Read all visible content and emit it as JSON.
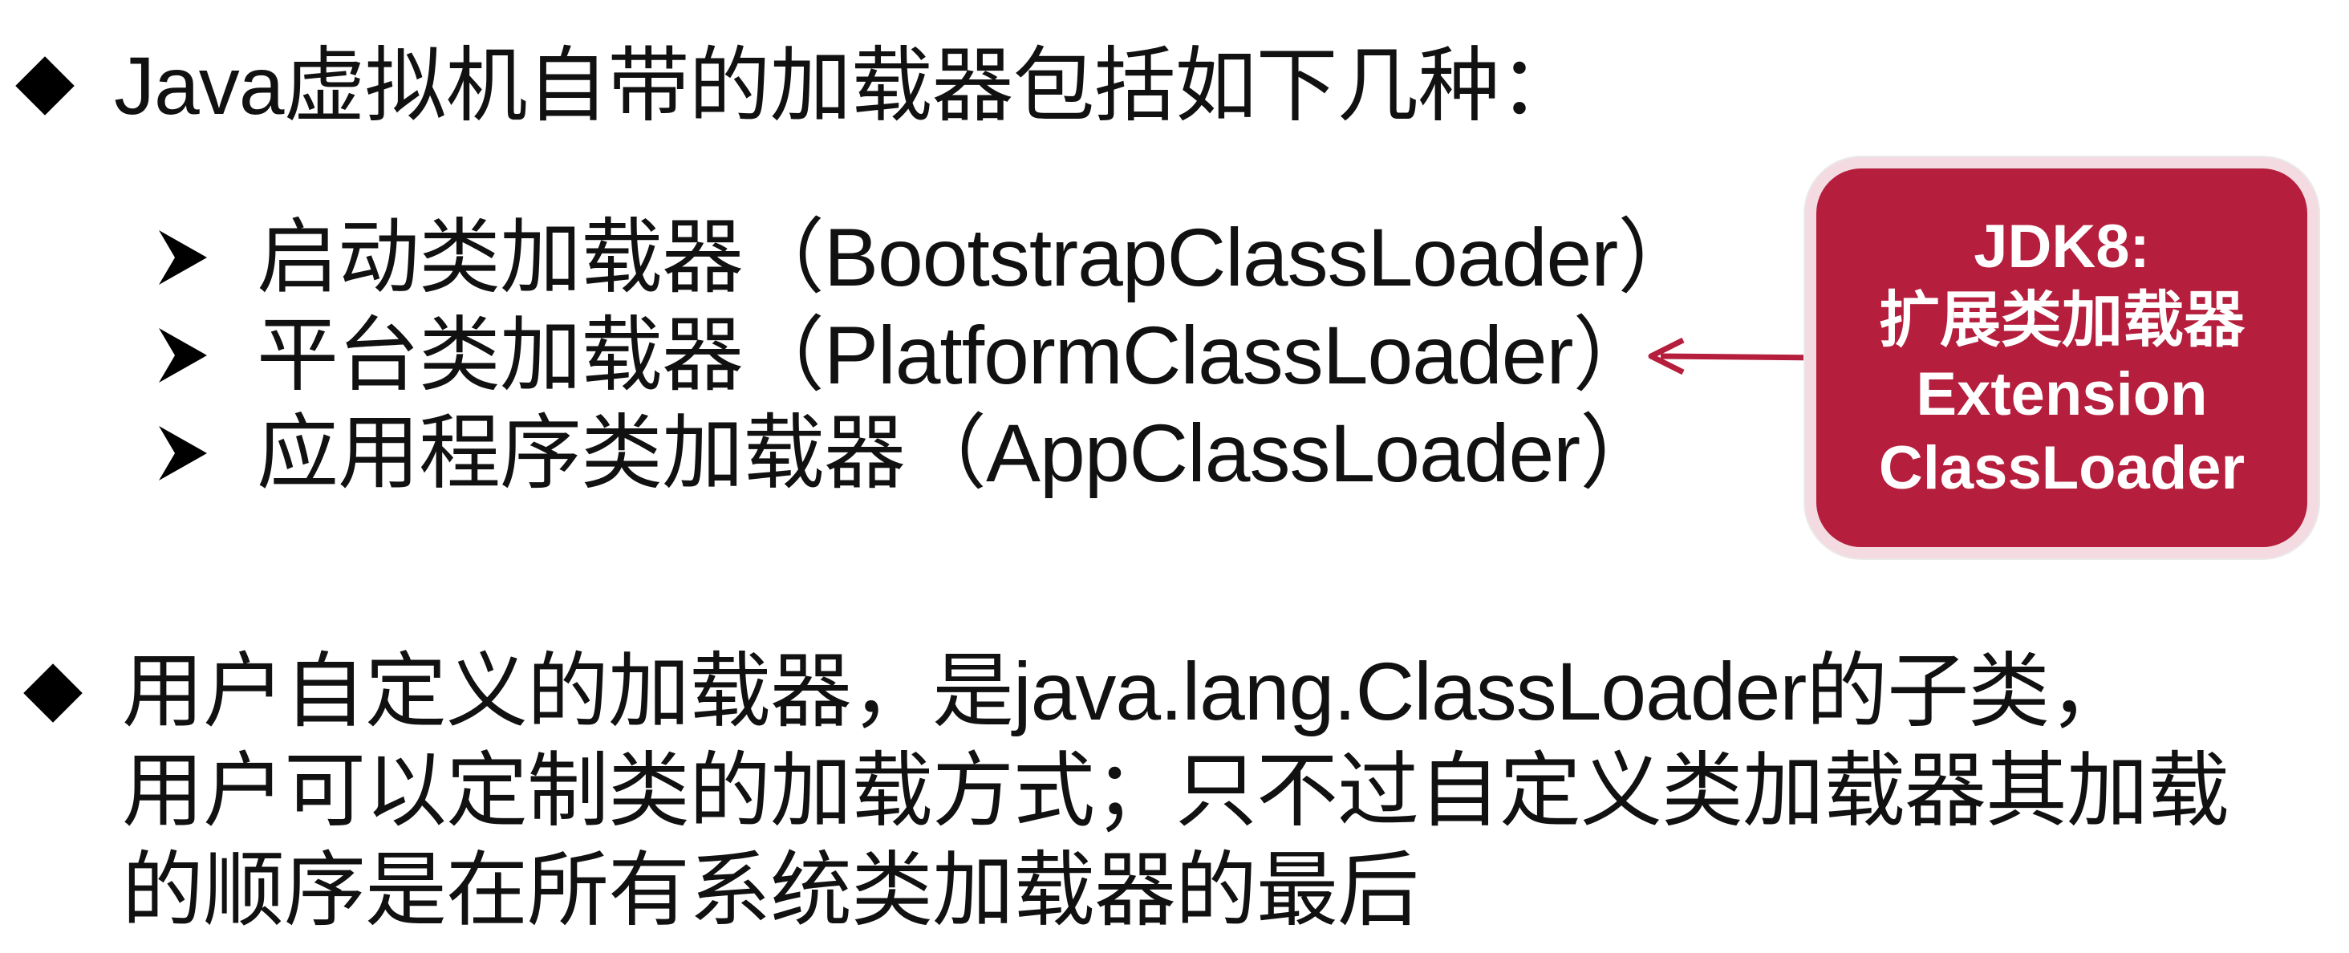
{
  "section1": {
    "heading": "Java虚拟机自带的加载器包括如下几种："
  },
  "loaders": [
    {
      "label": "启动类加载器（BootstrapClassLoader）"
    },
    {
      "label": "平台类加载器（PlatformClassLoader）"
    },
    {
      "label": "应用程序类加载器（AppClassLoader）"
    }
  ],
  "callout": {
    "line1": "JDK8:",
    "line2": "扩展类加载器",
    "line3": "Extension",
    "line4": "ClassLoader",
    "fill_color": "#b51e3c",
    "arrow_color": "#b51e3c"
  },
  "section2": {
    "line1": "用户自定义的加载器，是java.lang.ClassLoader的子类，",
    "line2": "用户可以定制类的加载方式；只不过自定义类加载器其加载",
    "line3": "的顺序是在所有系统类加载器的最后"
  }
}
